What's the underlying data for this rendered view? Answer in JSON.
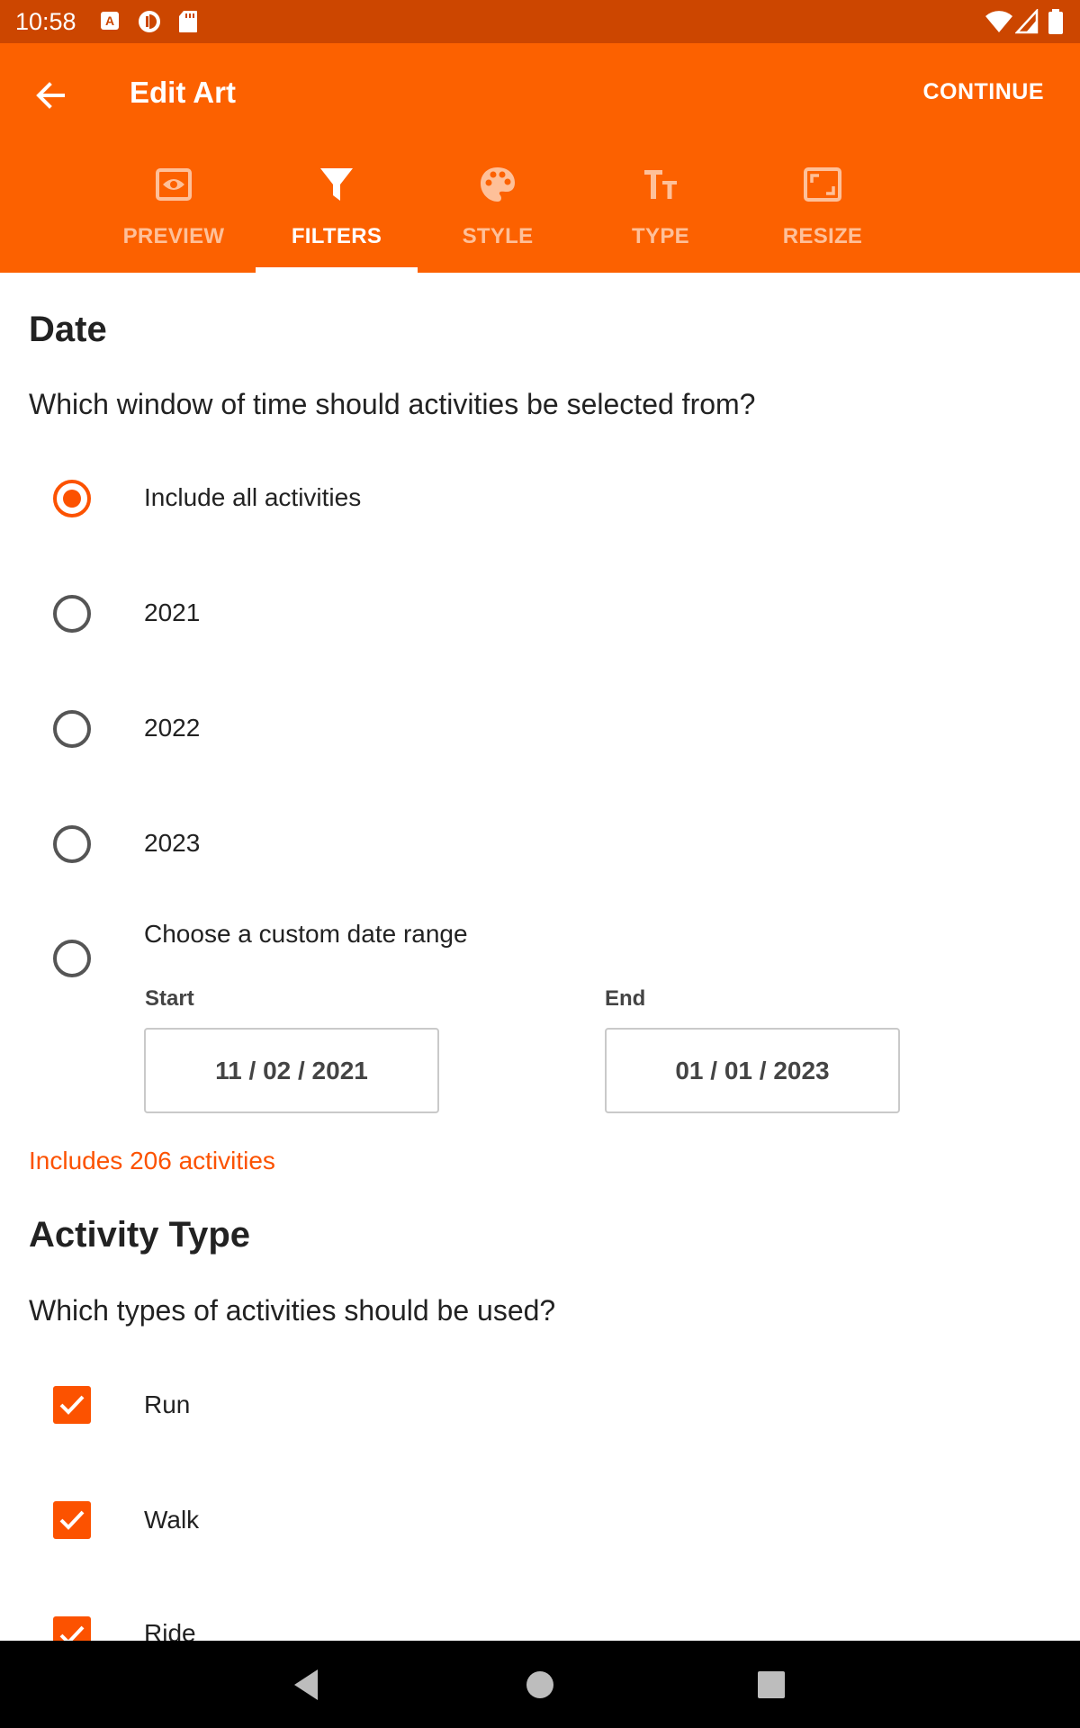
{
  "status_bar": {
    "time": "10:58",
    "icons": [
      "app-notification-icon",
      "data-saver-icon",
      "sd-card-icon",
      "wifi-icon",
      "cell-signal-icon",
      "battery-icon"
    ]
  },
  "app_bar": {
    "title": "Edit Art",
    "continue_label": "CONTINUE",
    "back_icon": "arrow-left-icon"
  },
  "tabs": [
    {
      "label": "PREVIEW",
      "icon": "eye-icon",
      "active": false
    },
    {
      "label": "FILTERS",
      "icon": "filter-icon",
      "active": true
    },
    {
      "label": "STYLE",
      "icon": "palette-icon",
      "active": false
    },
    {
      "label": "TYPE",
      "icon": "text-size-icon",
      "active": false
    },
    {
      "label": "RESIZE",
      "icon": "resize-icon",
      "active": false
    }
  ],
  "date_section": {
    "title": "Date",
    "question": "Which window of time should activities be selected from?",
    "options": [
      {
        "label": "Include all activities",
        "selected": true
      },
      {
        "label": "2021",
        "selected": false
      },
      {
        "label": "2022",
        "selected": false
      },
      {
        "label": "2023",
        "selected": false
      },
      {
        "label": "Choose a custom date range",
        "selected": false
      }
    ],
    "start_label": "Start",
    "start_value": "11 / 02 / 2021",
    "end_label": "End",
    "end_value": "01 / 01 / 2023",
    "includes_text": "Includes 206 activities"
  },
  "activity_section": {
    "title": "Activity Type",
    "question": "Which types of activities should be used?",
    "types": [
      {
        "label": "Run",
        "checked": true
      },
      {
        "label": "Walk",
        "checked": true
      },
      {
        "label": "Ride",
        "checked": true
      }
    ]
  },
  "colors": {
    "status_bar": "#CC4600",
    "app_bar": "#FC6100",
    "accent": "#FC5200"
  }
}
